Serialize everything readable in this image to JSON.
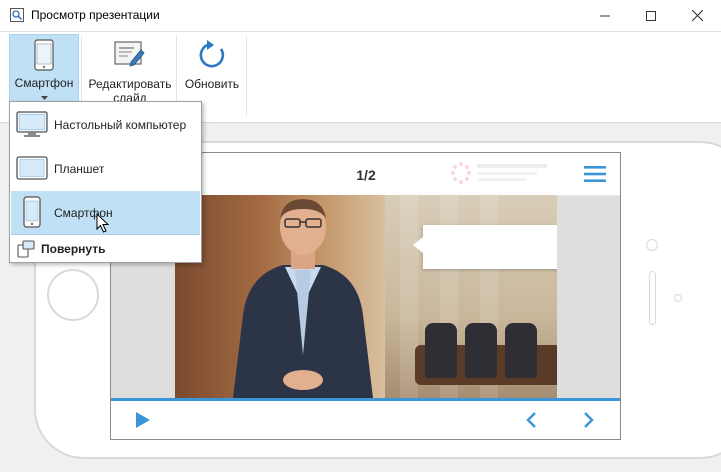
{
  "window": {
    "title": "Просмотр презентации"
  },
  "ribbon": {
    "device_button": {
      "label": "Смартфон"
    },
    "edit_button": {
      "label_line1": "Редактировать",
      "label_line2": "слайд"
    },
    "refresh_button": {
      "label": "Обновить"
    }
  },
  "device_menu": {
    "items": [
      {
        "label": "Настольный компьютер",
        "icon": "desktop-monitor-icon",
        "selected": false
      },
      {
        "label": "Планшет",
        "icon": "tablet-icon",
        "selected": false
      },
      {
        "label": "Смартфон",
        "icon": "smartphone-icon",
        "selected": true
      }
    ],
    "rotate_label": "Повернуть"
  },
  "player": {
    "slide_counter": "1/2",
    "accent_color": "#3a96d8"
  },
  "colors": {
    "ribbon_active": "#bfe0f5",
    "accent": "#3a96d8"
  }
}
